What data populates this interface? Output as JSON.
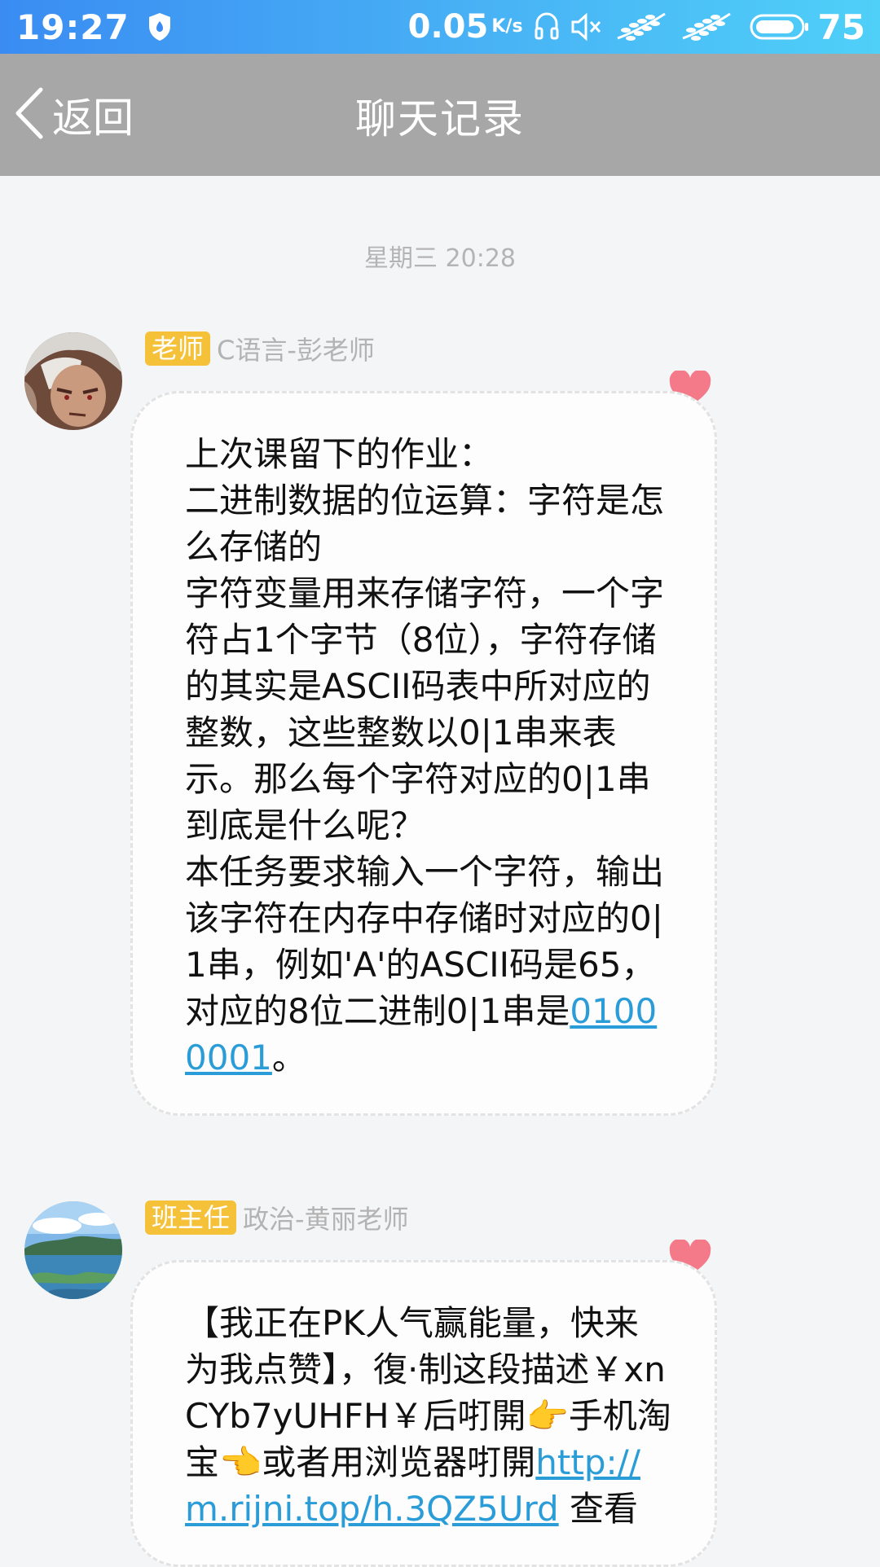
{
  "status_bar": {
    "time": "19:27",
    "net_speed": "0.05",
    "net_speed_unit": "K/s",
    "battery": "75",
    "icons": [
      "shield-icon",
      "headset-icon",
      "mute-icon",
      "laurel-icon",
      "laurel-icon",
      "battery-icon"
    ]
  },
  "nav": {
    "back_label": "返回",
    "title": "聊天记录"
  },
  "chat": {
    "date": "星期三 20:28",
    "messages": [
      {
        "role": "老师",
        "sender": "C语言-彭老师",
        "text_before": "上次课留下的作业：\n二进制数据的位运算：字符是怎么存储的\n字符变量用来存储字符，一个字符占1个字节（8位），字符存储的其实是ASCII码表中所对应的整数，这些整数以0|1串来表示。那么每个字符对应的0|1串到底是什么呢？\n本任务要求输入一个字符，输出该字符在内存中存储时对应的0|1串，例如'A'的ASCII码是65，对应的8位二进制0|1串是",
        "link": "01000001",
        "text_after": "。"
      },
      {
        "role": "班主任",
        "sender": "政治-黄丽老师",
        "text_before": "【我正在PK人气赢能量，快来为我点赞】，復·制这段描述￥xnCYb7yUHFH￥后咑開👉手机淘宝👈或者用浏览器咑開",
        "link": "http://m.rijni.top/h.3QZ5Urd",
        "text_after": " 查看"
      }
    ]
  },
  "colors": {
    "status_bar_start": "#3a8cf2",
    "status_bar_end": "#4fd0f8",
    "nav_bg": "#a7a7a7",
    "badge": "#f4c139",
    "link": "#2a9cd7",
    "heart": "#f47a8a"
  }
}
